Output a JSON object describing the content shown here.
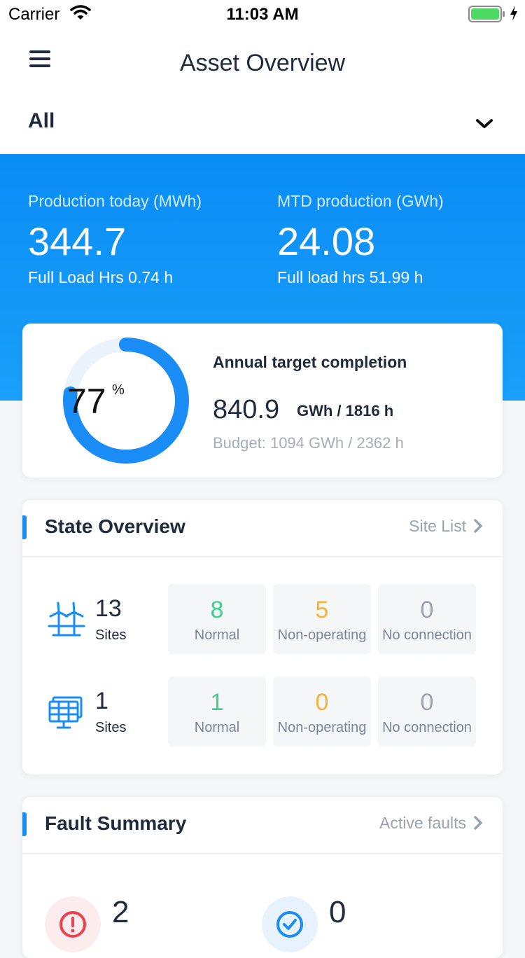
{
  "status_bar": {
    "carrier": "Carrier",
    "time": "11:03 AM"
  },
  "nav": {
    "title": "Asset Overview"
  },
  "filter": {
    "selected": "All"
  },
  "production": {
    "today": {
      "label": "Production today (MWh)",
      "value": "344.7",
      "sub": "Full Load Hrs 0.74 h"
    },
    "mtd": {
      "label": "MTD production (GWh)",
      "value": "24.08",
      "sub": "Full load hrs 51.99 h"
    }
  },
  "annual": {
    "title": "Annual target completion",
    "percent": "77",
    "percent_unit": "%",
    "progress": 0.77,
    "value": "840.9",
    "unit": "GWh / 1816 h",
    "budget": "Budget: 1094 GWh / 2362 h"
  },
  "state_overview": {
    "title": "State Overview",
    "link": "Site List",
    "rows": [
      {
        "icon": "wind-turbine-icon",
        "count": "13",
        "unit": "Sites",
        "stats": [
          {
            "value": "8",
            "label": "Normal",
            "color": "#3ecf8e"
          },
          {
            "value": "5",
            "label": "Non-operating",
            "color": "#f5b335"
          },
          {
            "value": "0",
            "label": "No connection",
            "color": "#9aa3ae"
          }
        ]
      },
      {
        "icon": "solar-panel-icon",
        "count": "1",
        "unit": "Sites",
        "stats": [
          {
            "value": "1",
            "label": "Normal",
            "color": "#3ecf8e"
          },
          {
            "value": "0",
            "label": "Non-operating",
            "color": "#f5b335"
          },
          {
            "value": "0",
            "label": "No connection",
            "color": "#9aa3ae"
          }
        ]
      }
    ]
  },
  "fault_summary": {
    "title": "Fault Summary",
    "link": "Active faults",
    "items": [
      {
        "icon": "alert-icon",
        "count": "2"
      },
      {
        "icon": "check-circle-icon",
        "count": "0"
      }
    ]
  },
  "colors": {
    "primary": "#1a8cf5",
    "normal": "#3ecf8e",
    "warning": "#f5b335",
    "muted": "#9aa3ae",
    "fault": "#e9414d"
  }
}
